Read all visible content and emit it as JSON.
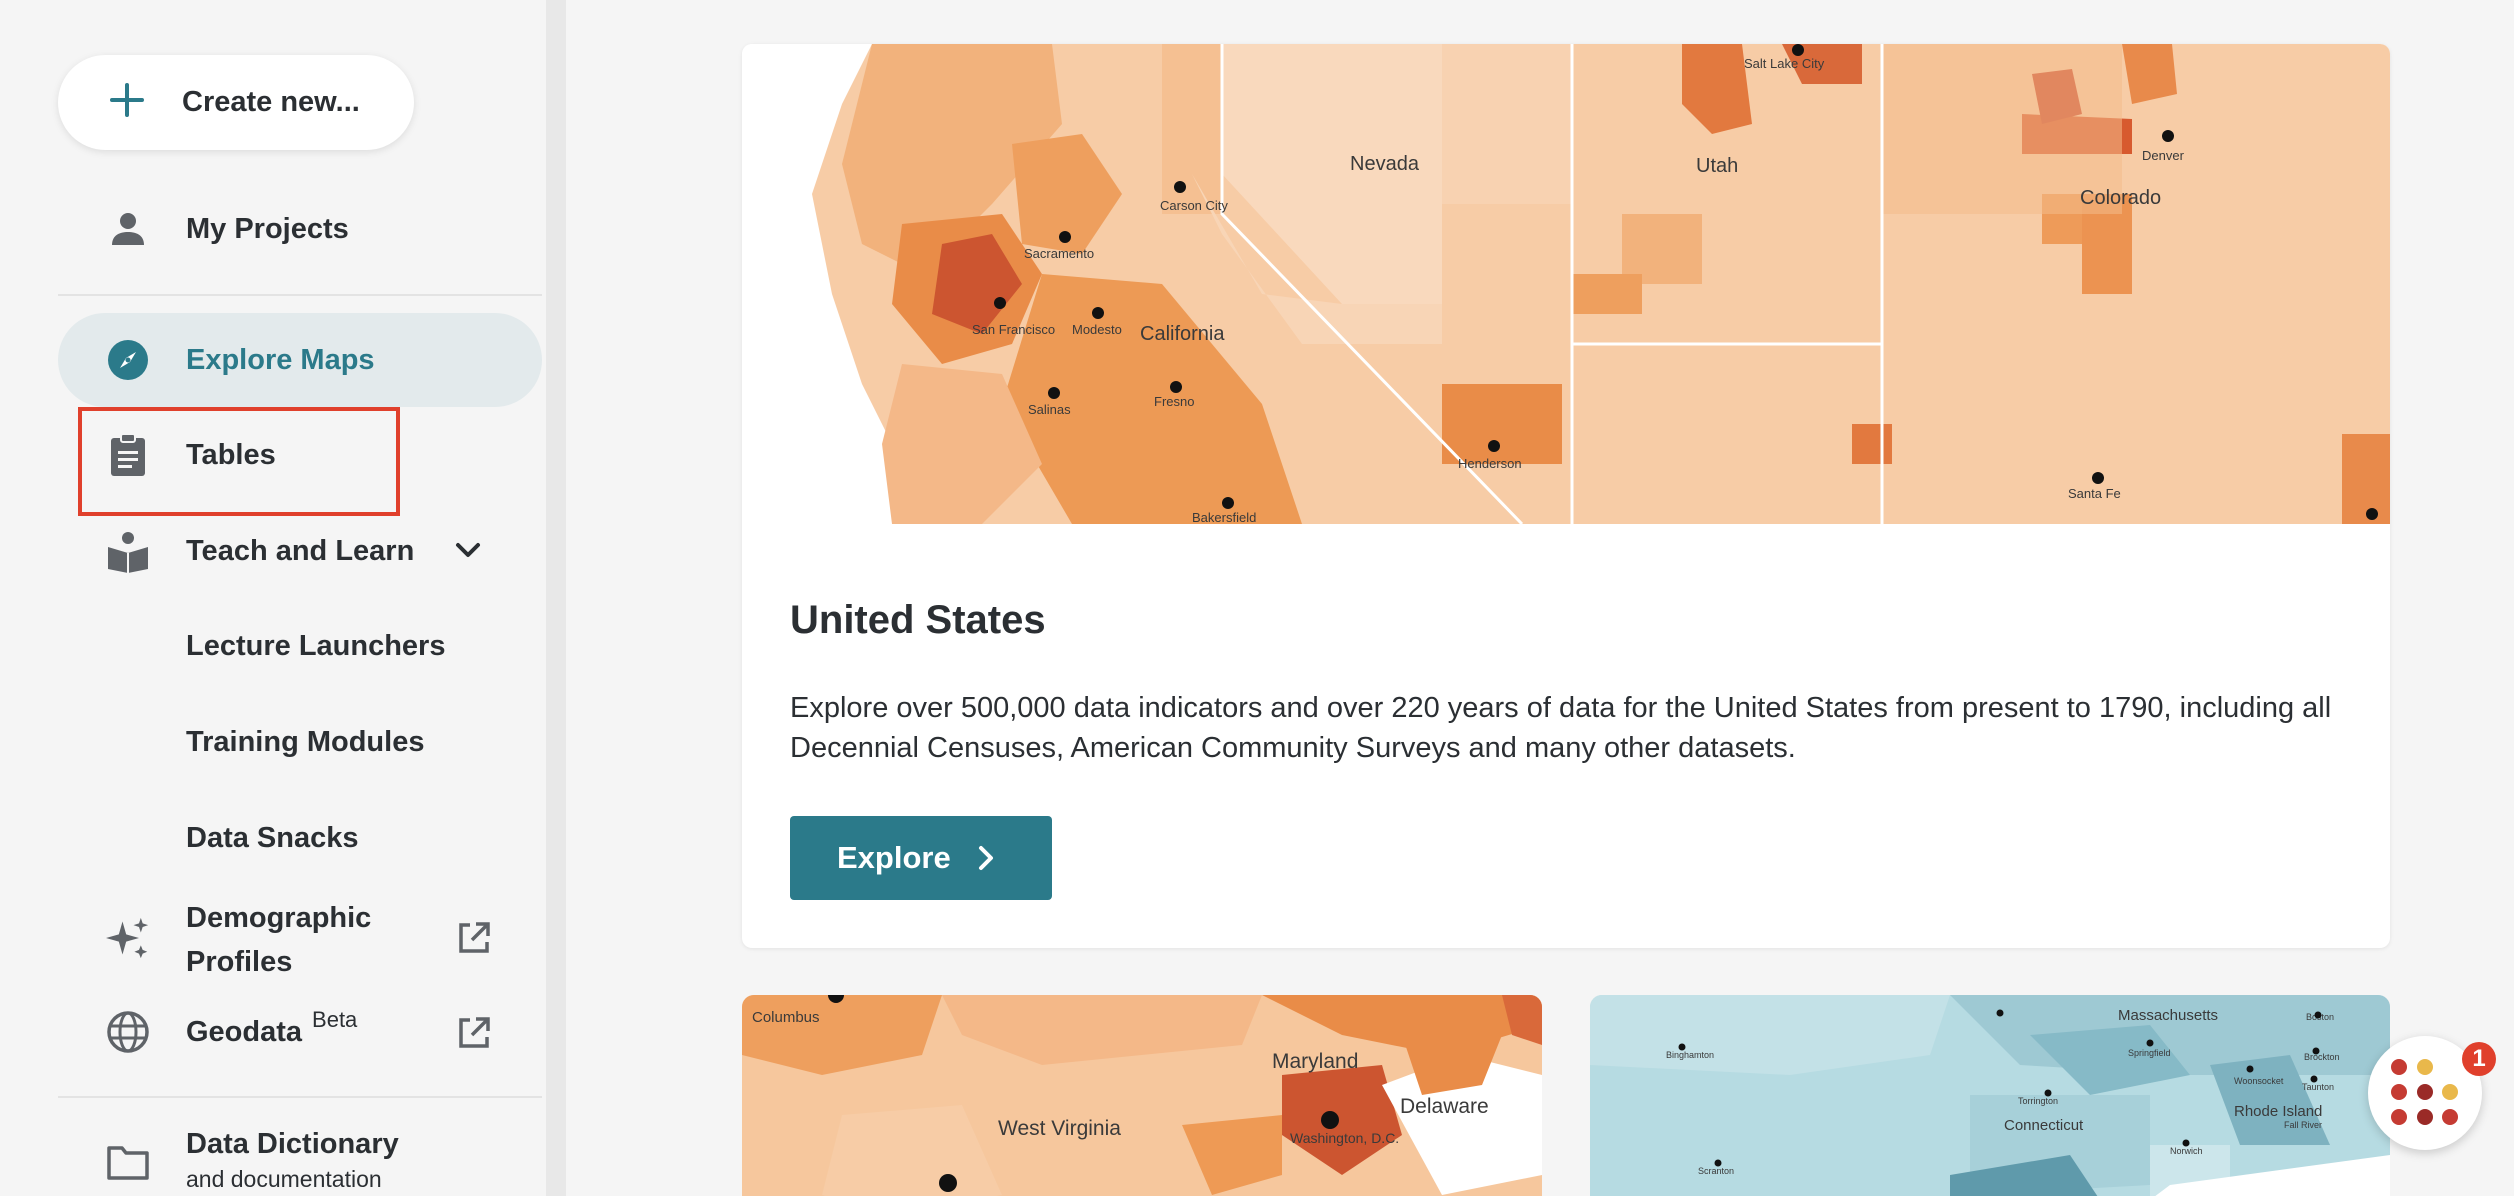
{
  "sidebar": {
    "create_label": "Create new...",
    "my_projects": "My Projects",
    "explore_maps": "Explore Maps",
    "tables": "Tables",
    "teach_and_learn": "Teach and Learn",
    "sub_items": [
      "Lecture Launchers",
      "Training Modules",
      "Data Snacks"
    ],
    "demographic_profiles_line1": "Demographic",
    "demographic_profiles_line2": "Profiles",
    "geodata": "Geodata",
    "geodata_badge": "Beta",
    "data_dictionary": "Data Dictionary",
    "data_dictionary_sub": "and documentation"
  },
  "main": {
    "featured": {
      "title": "United States",
      "description": "Explore over 500,000 data indicators and over 220 years of data for the United States from present to 1790, including all Decennial Censuses, American Community Surveys and many other datasets.",
      "button_label": "Explore"
    },
    "map_labels": {
      "nevada": "Nevada",
      "utah": "Utah",
      "colorado": "Colorado",
      "california": "California",
      "carson_city": "Carson City",
      "sacramento": "Sacramento",
      "san_francisco": "San Francisco",
      "modesto": "Modesto",
      "fresno": "Fresno",
      "salinas": "Salinas",
      "bakersfield": "Bakersfield",
      "henderson": "Henderson",
      "santa_fe": "Santa Fe",
      "denver": "Denver",
      "salt_lake": "Salt Lake City",
      "maryland": "Maryland",
      "delaware": "Delaware",
      "west_virginia": "West Virginia",
      "washington": "Washington, D.C.",
      "columbus": "Columbus",
      "massachusetts": "Massachusetts",
      "connecticut": "Connecticut",
      "rhode_island": "Rhode Island",
      "springfield": "Springfield",
      "binghamton": "Binghamton",
      "torrington": "Torrington",
      "scranton": "Scranton",
      "norwich": "Norwich",
      "brockton": "Brockton",
      "woonsocket": "Woonsocket",
      "boston": "Boston",
      "taunton": "Taunton",
      "fall_river": "Fall River"
    },
    "chat_badge_count": "1"
  },
  "colors": {
    "accent": "#2b7a8a",
    "active_bg": "#e3eaec",
    "highlight": "#e0402c"
  }
}
